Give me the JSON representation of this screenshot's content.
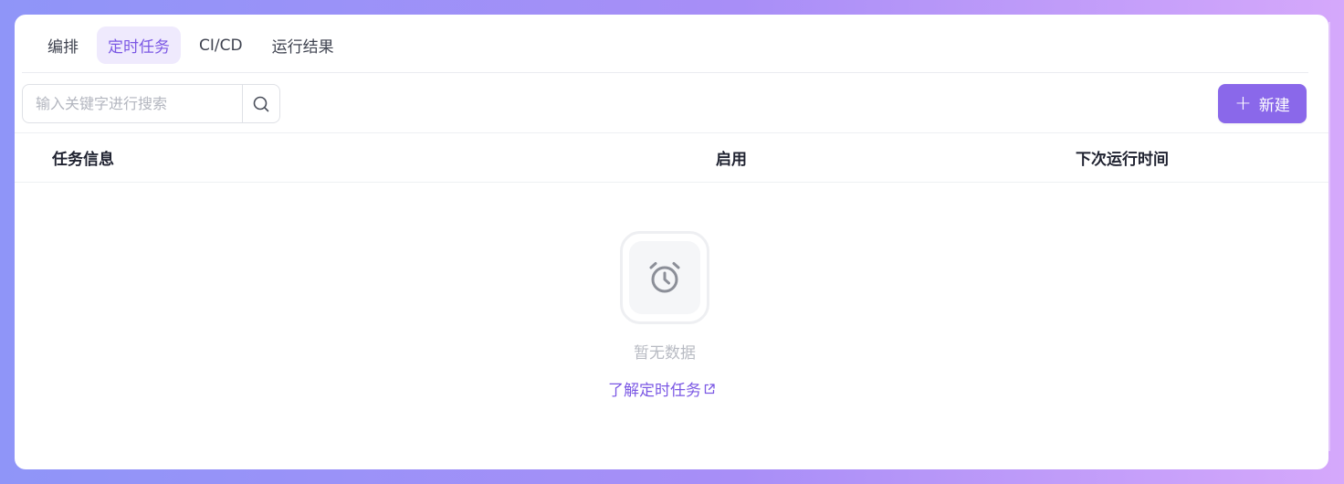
{
  "tabs": [
    {
      "label": "编排"
    },
    {
      "label": "定时任务"
    },
    {
      "label": "CI/CD"
    },
    {
      "label": "运行结果"
    }
  ],
  "toolbar": {
    "search_placeholder": "输入关键字进行搜索",
    "new_label": "新建"
  },
  "table": {
    "columns": [
      "任务信息",
      "启用",
      "下次运行时间"
    ]
  },
  "empty": {
    "text": "暂无数据",
    "link": "了解定时任务"
  },
  "colors": {
    "accent": "#8a68ea",
    "accent_text": "#7b58e4"
  }
}
